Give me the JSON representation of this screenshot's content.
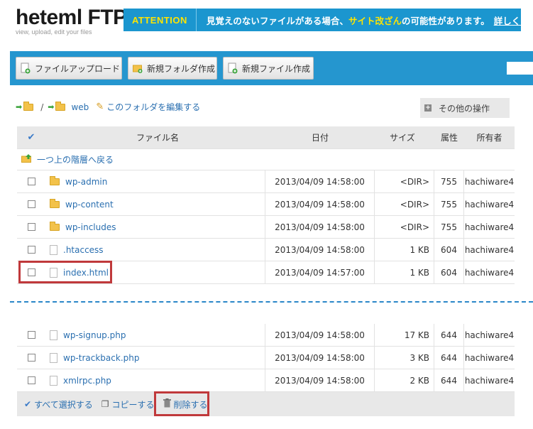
{
  "header": {
    "logo_title": "heteml FTP",
    "logo_subtitle": "view, upload, edit your files",
    "attention_label": "ATTENTION",
    "attention_text_before": "見覚えのないファイルがある場合、",
    "attention_highlight": "サイト改ざん",
    "attention_text_after": "の可能性があります。",
    "attention_link": "詳しくはこちら"
  },
  "toolbar": {
    "upload_label": "ファイルアップロード",
    "new_folder_label": "新規フォルダ作成",
    "new_file_label": "新規ファイル作成"
  },
  "breadcrumb": {
    "root": "/",
    "folder": "web",
    "edit_label": "このフォルダを編集する"
  },
  "other_ops_label": "その他の操作",
  "table": {
    "headers": {
      "name": "ファイル名",
      "date": "日付",
      "size": "サイズ",
      "perm": "属性",
      "owner": "所有者"
    },
    "up_label": "一つ上の階層へ戻る",
    "rows_top": [
      {
        "type": "folder",
        "name": "wp-admin",
        "date": "2013/04/09 14:58:00",
        "size": "<DIR>",
        "perm": "755",
        "owner": "hachiware4"
      },
      {
        "type": "folder",
        "name": "wp-content",
        "date": "2013/04/09 14:58:00",
        "size": "<DIR>",
        "perm": "755",
        "owner": "hachiware4"
      },
      {
        "type": "folder",
        "name": "wp-includes",
        "date": "2013/04/09 14:58:00",
        "size": "<DIR>",
        "perm": "755",
        "owner": "hachiware4"
      },
      {
        "type": "file",
        "name": ".htaccess",
        "date": "2013/04/09 14:58:00",
        "size": "1 KB",
        "perm": "604",
        "owner": "hachiware4"
      },
      {
        "type": "file",
        "name": "index.html",
        "date": "2013/04/09 14:57:00",
        "size": "1 KB",
        "perm": "604",
        "owner": "hachiware4"
      }
    ],
    "rows_bottom": [
      {
        "type": "file",
        "name": "wp-signup.php",
        "date": "2013/04/09 14:58:00",
        "size": "17 KB",
        "perm": "644",
        "owner": "hachiware4"
      },
      {
        "type": "file",
        "name": "wp-trackback.php",
        "date": "2013/04/09 14:58:00",
        "size": "3 KB",
        "perm": "644",
        "owner": "hachiware4"
      },
      {
        "type": "file",
        "name": "xmlrpc.php",
        "date": "2013/04/09 14:58:00",
        "size": "2 KB",
        "perm": "644",
        "owner": "hachiware4"
      }
    ]
  },
  "footer": {
    "select_all": "すべて選択する",
    "copy": "コピーする",
    "delete": "削除する"
  },
  "colors": {
    "accent": "#2596cf",
    "highlight": "#ffe400",
    "link": "#2a6fb0",
    "annotation_red": "#c0393b"
  }
}
